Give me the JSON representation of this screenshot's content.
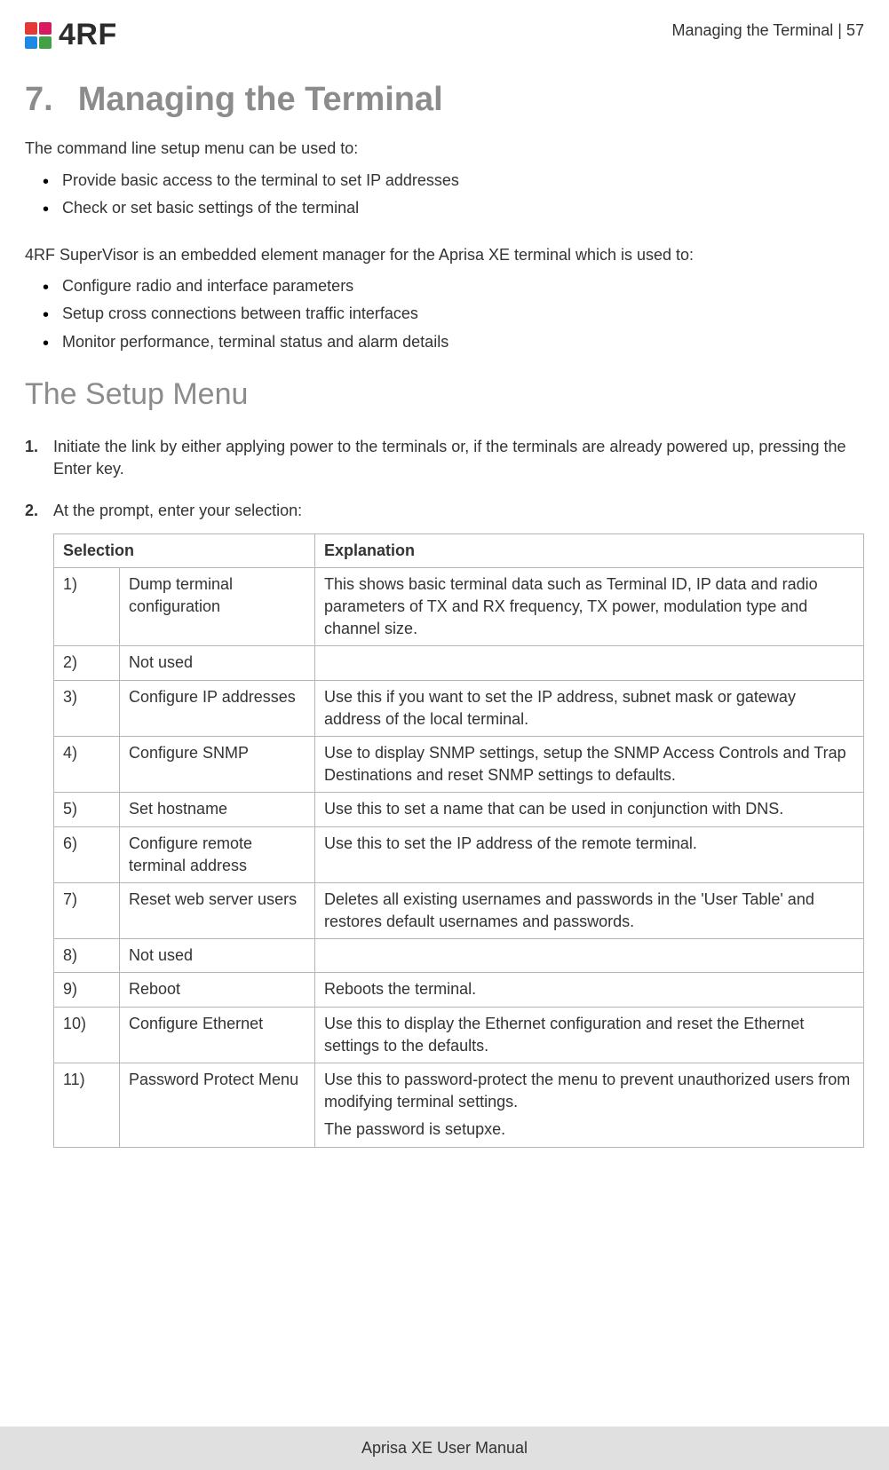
{
  "header": {
    "logo_text": "4RF",
    "page_header": "Managing the Terminal  |  57"
  },
  "chapter": {
    "number": "7.",
    "title": "Managing the Terminal"
  },
  "intro1": "The command line setup menu can be used to:",
  "list1": [
    "Provide basic access to the terminal to set IP addresses",
    "Check or set basic settings of the terminal"
  ],
  "intro2": "4RF SuperVisor is an embedded element manager for the Aprisa XE terminal which is used to:",
  "list2": [
    "Configure radio and interface parameters",
    "Setup cross connections between traffic interfaces",
    "Monitor performance, terminal status and alarm details"
  ],
  "section_title": "The Setup Menu",
  "steps": {
    "s1": "Initiate the link by either applying power to the terminals or, if the terminals are already powered up, pressing the Enter key.",
    "s2": "At the prompt, enter your selection:"
  },
  "table": {
    "head": {
      "c1": "Selection",
      "c2": "Explanation"
    },
    "rows": [
      {
        "num": "1)",
        "sel": "Dump terminal configuration",
        "expl": "This shows basic terminal data such as Terminal ID, IP data and radio parameters of TX and RX frequency, TX power, modulation type and channel size."
      },
      {
        "num": "2)",
        "sel": "Not used",
        "expl": ""
      },
      {
        "num": "3)",
        "sel": "Configure IP addresses",
        "expl": "Use this if you want to set the IP address, subnet mask or gateway address of the local terminal."
      },
      {
        "num": "4)",
        "sel": "Configure SNMP",
        "expl": "Use to display SNMP settings, setup the SNMP Access Controls and Trap Destinations and reset SNMP settings to defaults."
      },
      {
        "num": "5)",
        "sel": "Set hostname",
        "expl": "Use this to set a name that can be used in conjunction with DNS."
      },
      {
        "num": "6)",
        "sel": "Configure remote terminal address",
        "expl": "Use this to set the IP address of the remote terminal."
      },
      {
        "num": "7)",
        "sel": "Reset web server users",
        "expl": "Deletes all existing usernames and passwords in the 'User Table' and restores default usernames and passwords."
      },
      {
        "num": "8)",
        "sel": "Not used",
        "expl": ""
      },
      {
        "num": "9)",
        "sel": "Reboot",
        "expl": "Reboots the terminal."
      },
      {
        "num": "10)",
        "sel": "Configure Ethernet",
        "expl": "Use this to display the Ethernet configuration and reset the Ethernet settings to the defaults."
      },
      {
        "num": "11)",
        "sel": "Password Protect Menu",
        "expl_multi": [
          "Use this to password-protect the menu to prevent unauthorized users from modifying terminal settings.",
          "The password is setupxe."
        ]
      }
    ]
  },
  "footer": "Aprisa XE User Manual"
}
